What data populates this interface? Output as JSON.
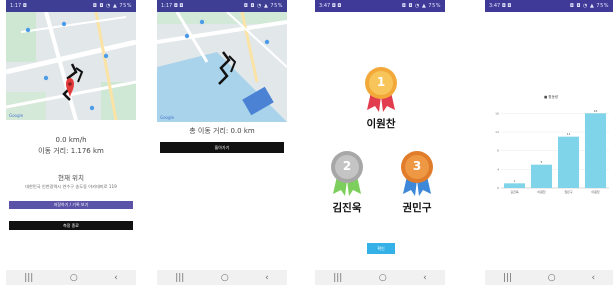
{
  "status_bar": {
    "left_p1": "1:17 ◘",
    "left_p2": "1:17 ◘ ◘",
    "left_p3": "3:47 ◘ ◘",
    "left_p4": "3:47 ◘ ◘",
    "right": "◘ ◘ ◔ ▲ 75%"
  },
  "screen1": {
    "speed": "0.0 km/h",
    "distance": "이동 거리: 1.176 km",
    "location_title": "현재 위치",
    "location_address": "대한민국 인천광역시 연수구 송도동 아카데미로 119",
    "btn_purple": "저장하기 / 기록 보기",
    "btn_black": "측정 종료",
    "map_logo": "Google"
  },
  "screen2": {
    "total_distance": "총 이동 거리: 0.0 km",
    "btn_black": "돌아가기",
    "map_logo": "Google"
  },
  "screen3": {
    "first": {
      "rank": "1",
      "name": "이원찬"
    },
    "second": {
      "rank": "2",
      "name": "김진욱"
    },
    "third": {
      "rank": "3",
      "name": "권민구"
    },
    "confirm_button": "확인"
  },
  "nav": {
    "back": "‹",
    "home": "○",
    "recents": "|||"
  },
  "colors": {
    "gold": "#f2a93a",
    "silver": "#a7a7a7",
    "bronze": "#e07c2a",
    "ribbon_red": "#e23d4f",
    "ribbon_green": "#7ccf5c",
    "ribbon_blue": "#3d88d9",
    "bar": "#80d4ea",
    "status": "#3f3a97"
  },
  "chart_data": {
    "type": "bar",
    "legend": "■ 활동량",
    "categories": [
      "김진욱",
      "이원찬",
      "권민구",
      "이원찬"
    ],
    "values": [
      1,
      5,
      11,
      16
    ],
    "value_labels": [
      "1",
      "5",
      "11",
      "16"
    ],
    "ylim": [
      0,
      18
    ],
    "y_ticks": [
      "0",
      "4",
      "8",
      "12",
      "16"
    ]
  }
}
